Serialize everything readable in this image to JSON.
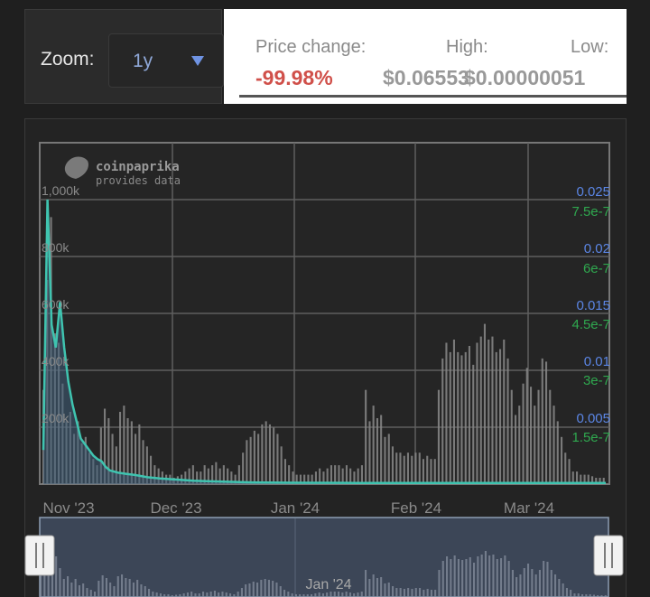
{
  "zoom": {
    "label": "Zoom:",
    "value": "1y"
  },
  "stats": {
    "price_change_label": "Price change:",
    "price_change_value": "-99.98%",
    "high_label": "High:",
    "high_value": "$0.06553",
    "low_label": "Low:",
    "low_value": "$0.00000051"
  },
  "watermark": {
    "brand": "coinpaprika",
    "tagline": "provides data"
  },
  "navigator": {
    "tick_label": "Jan '24"
  },
  "colors": {
    "price": "#3fc4b0",
    "volume_bars": "#8a8a8a",
    "price_axis": "#5b86e5",
    "market_cap": "#2fa84f",
    "negative_change": "#d0504a"
  },
  "chart_data": {
    "type": "line",
    "x_ticks": [
      "Nov '23",
      "Dec '23",
      "Jan '24",
      "Feb '24",
      "Mar '24"
    ],
    "volume_axis": {
      "ticks": [
        "1,000k",
        "800k",
        "600k",
        "400k",
        "200k"
      ]
    },
    "price_axis": {
      "ticks": [
        "0.025",
        "0.02",
        "0.015",
        "0.01",
        "0.005"
      ],
      "ylim": [
        0,
        0.03
      ]
    },
    "market_cap_axis": {
      "ticks": [
        "7.5e-7",
        "6e-7",
        "4.5e-7",
        "3e-7",
        "1.5e-7"
      ],
      "ylim": [
        0,
        9e-07
      ]
    },
    "grid": true,
    "series": [
      {
        "kind": "line",
        "x_days": [
          0,
          1,
          2,
          3,
          4,
          5,
          6,
          7,
          8,
          9,
          10,
          11,
          12,
          13,
          14,
          15,
          16,
          18,
          20,
          22,
          25,
          28,
          32,
          36,
          40,
          45,
          50,
          60,
          75,
          90,
          105,
          120,
          135
        ],
        "values": [
          0.003,
          0.025,
          0.014,
          0.012,
          0.016,
          0.012,
          0.009,
          0.007,
          0.0055,
          0.004,
          0.0035,
          0.003,
          0.0025,
          0.0022,
          0.002,
          0.0015,
          0.0012,
          0.001,
          0.0009,
          0.0008,
          0.0006,
          0.0005,
          0.0004,
          0.0003,
          0.00025,
          0.0002,
          0.00015,
          0.00012,
          0.0001,
          0.0001,
          0.0001,
          0.0001,
          0.0001
        ]
      },
      {
        "kind": "bars",
        "values": [
          300,
          650,
          850,
          480,
          450,
          320,
          200,
          230,
          160,
          200,
          130,
          150,
          100,
          80,
          60,
          180,
          240,
          210,
          160,
          120,
          230,
          250,
          210,
          200,
          160,
          190,
          140,
          120,
          90,
          60,
          50,
          40,
          30,
          30,
          20,
          25,
          30,
          40,
          50,
          60,
          40,
          40,
          60,
          50,
          60,
          70,
          50,
          60,
          50,
          40,
          30,
          60,
          100,
          140,
          150,
          170,
          160,
          190,
          200,
          190,
          180,
          160,
          120,
          80,
          60,
          40,
          30,
          30,
          30,
          30,
          30,
          40,
          50,
          40,
          50,
          60,
          60,
          60,
          50,
          60,
          50,
          40,
          50,
          60,
          300,
          200,
          250,
          210,
          220,
          150,
          160,
          120,
          100,
          100,
          90,
          100,
          90,
          100,
          100,
          80,
          90,
          80,
          80,
          300,
          400,
          450,
          420,
          460,
          420,
          410,
          420,
          440,
          380,
          450,
          470,
          510,
          460,
          470,
          420,
          430,
          460,
          400,
          300,
          220,
          250,
          320,
          370,
          310,
          250,
          300,
          400,
          390,
          300,
          250,
          200,
          150,
          100,
          80,
          40,
          40,
          30,
          30,
          30,
          25,
          20,
          20,
          20
        ]
      }
    ]
  }
}
